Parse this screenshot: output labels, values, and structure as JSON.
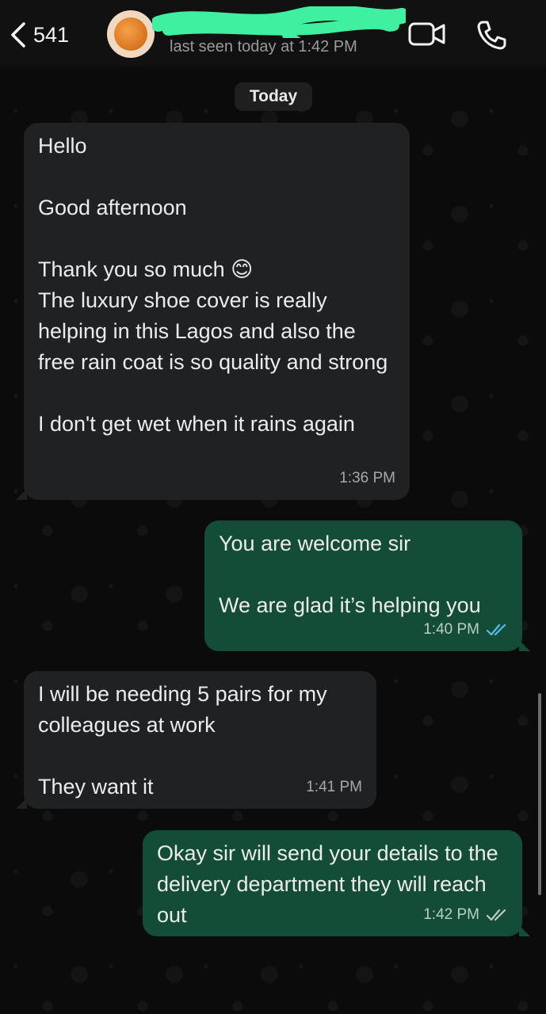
{
  "header": {
    "back_count": "541",
    "last_seen": "last seen today at 1:42 PM",
    "colors": {
      "bar": "#111111",
      "redaction": "#3ef0a0"
    },
    "icons": [
      "chevron-left-icon",
      "video-call-icon",
      "phone-icon"
    ]
  },
  "chat": {
    "date_label": "Today",
    "messages": [
      {
        "direction": "incoming",
        "text": "Hello\n\nGood afternoon\n\nThank you so much 😊\nThe luxury shoe cover is really helping in this Lagos and also the free rain coat is so quality and strong\n\nI don't get wet when it rains again",
        "time": "1:36 PM"
      },
      {
        "direction": "outgoing",
        "text": "You are welcome sir\n\nWe are glad it’s helping you",
        "time": "1:40 PM",
        "status": "read"
      },
      {
        "direction": "incoming",
        "text": "I will be needing 5 pairs for my colleagues at work\n\nThey want it",
        "time": "1:41 PM"
      },
      {
        "direction": "outgoing",
        "text": "Okay sir will send your details to the delivery department they will reach out",
        "time": "1:42 PM",
        "status": "delivered"
      }
    ],
    "colors": {
      "incoming_bubble": "#1f2123",
      "outgoing_bubble": "#144d37",
      "read_ticks": "#53bdeb",
      "delivered_ticks": "#b9cec3"
    }
  }
}
